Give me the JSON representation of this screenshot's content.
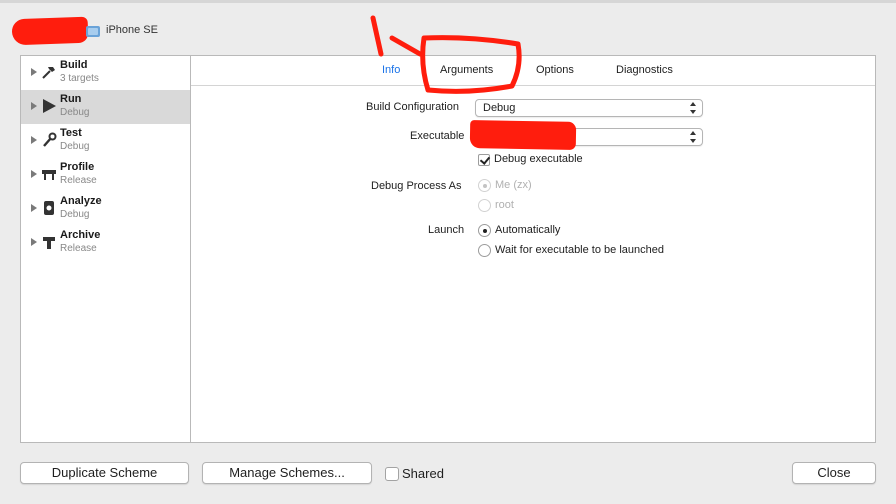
{
  "header": {
    "device_name": "iPhone SE"
  },
  "sidebar": {
    "items": [
      {
        "title": "Build",
        "subtitle": "3 targets",
        "icon": "hammer-icon"
      },
      {
        "title": "Run",
        "subtitle": "Debug",
        "icon": "play-icon"
      },
      {
        "title": "Test",
        "subtitle": "Debug",
        "icon": "wrench-icon"
      },
      {
        "title": "Profile",
        "subtitle": "Release",
        "icon": "gauge-icon"
      },
      {
        "title": "Analyze",
        "subtitle": "Debug",
        "icon": "analyze-icon"
      },
      {
        "title": "Archive",
        "subtitle": "Release",
        "icon": "archive-icon"
      }
    ],
    "selected": "Run"
  },
  "tabs": [
    "Info",
    "Arguments",
    "Options",
    "Diagnostics"
  ],
  "active_tab": "Info",
  "form": {
    "build_configuration_label": "Build Configuration",
    "build_configuration_value": "Debug",
    "executable_label": "Executable",
    "debug_executable_label": "Debug executable",
    "debug_executable_checked": true,
    "debug_process_as_label": "Debug Process As",
    "debug_process_options": [
      "Me (zx)",
      "root"
    ],
    "launch_label": "Launch",
    "launch_options": [
      "Automatically",
      "Wait for executable to be launched"
    ],
    "launch_selected": "Automatically"
  },
  "footer": {
    "duplicate_scheme": "Duplicate Scheme",
    "manage_schemes": "Manage Schemes...",
    "shared_label": "Shared",
    "close": "Close"
  },
  "colors": {
    "accent": "#1a73e8",
    "annotation_red": "#ff1d0d",
    "selection": "#d9d9d9"
  }
}
